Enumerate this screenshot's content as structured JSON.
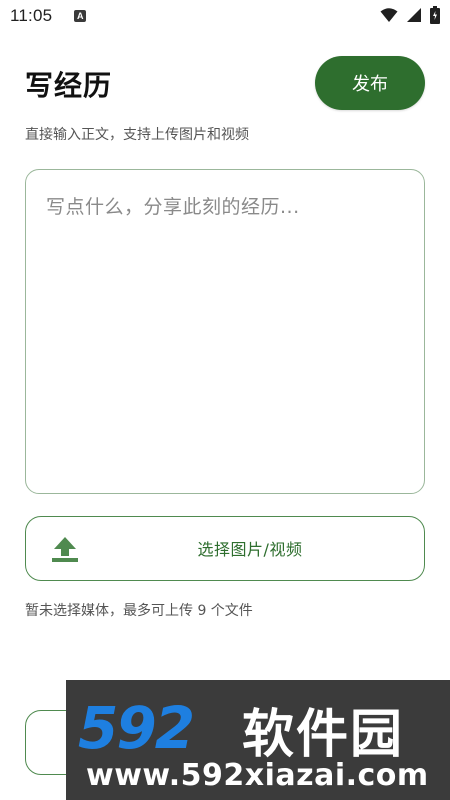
{
  "status_bar": {
    "time": "11:05",
    "notification_letter": "A",
    "icons": [
      "wifi-icon",
      "signal-icon",
      "battery-icon"
    ]
  },
  "header": {
    "title": "写经历",
    "publish_label": "发布",
    "subtitle": "直接输入正文，支持上传图片和视频"
  },
  "editor": {
    "placeholder": "写点什么，分享此刻的经历..."
  },
  "media": {
    "select_label": "选择图片/视频",
    "status_text": "暂未选择媒体，最多可上传 9 个文件",
    "icon": "upload-icon"
  },
  "watermark": {
    "logo_number": "592",
    "logo_text": "软件园",
    "url": "www.592xiazai.com"
  },
  "colors": {
    "accent": "#2e6e2e",
    "border": "#9bb79b",
    "watermark_bg": "#3b3b3b",
    "watermark_blue": "#1e7fe0"
  }
}
